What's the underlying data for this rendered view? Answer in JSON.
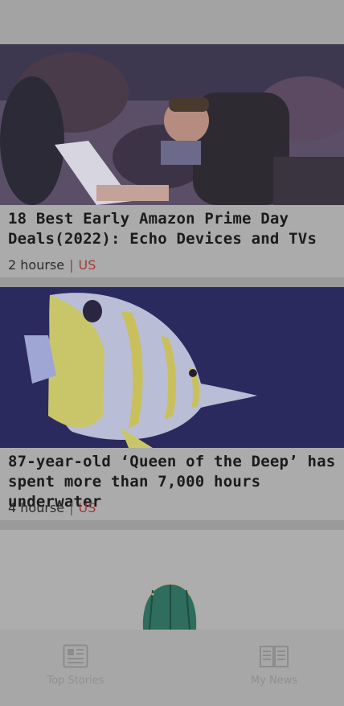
{
  "articles": [
    {
      "title": "18 Best Early Amazon Prime Day Deals(2022): Echo Devices and TVs",
      "time": "2 hourse",
      "separator": "|",
      "region": "US",
      "image": "people-working-on-laptops-photo"
    },
    {
      "title": "87-year-old ‘Queen of the Deep’ has spent more than 7,000 hours underwater",
      "time": "4 hourse",
      "separator": "|",
      "region": "US",
      "image": "butterflyfish-photo"
    },
    {
      "image": "cactus-photo"
    }
  ],
  "tabs": [
    {
      "label": "Top Stories",
      "icon": "newspaper-icon"
    },
    {
      "label": "My News",
      "icon": "open-book-icon"
    }
  ],
  "colors": {
    "overlay": "#9a9a9a",
    "region_accent": "#a43a3a"
  }
}
